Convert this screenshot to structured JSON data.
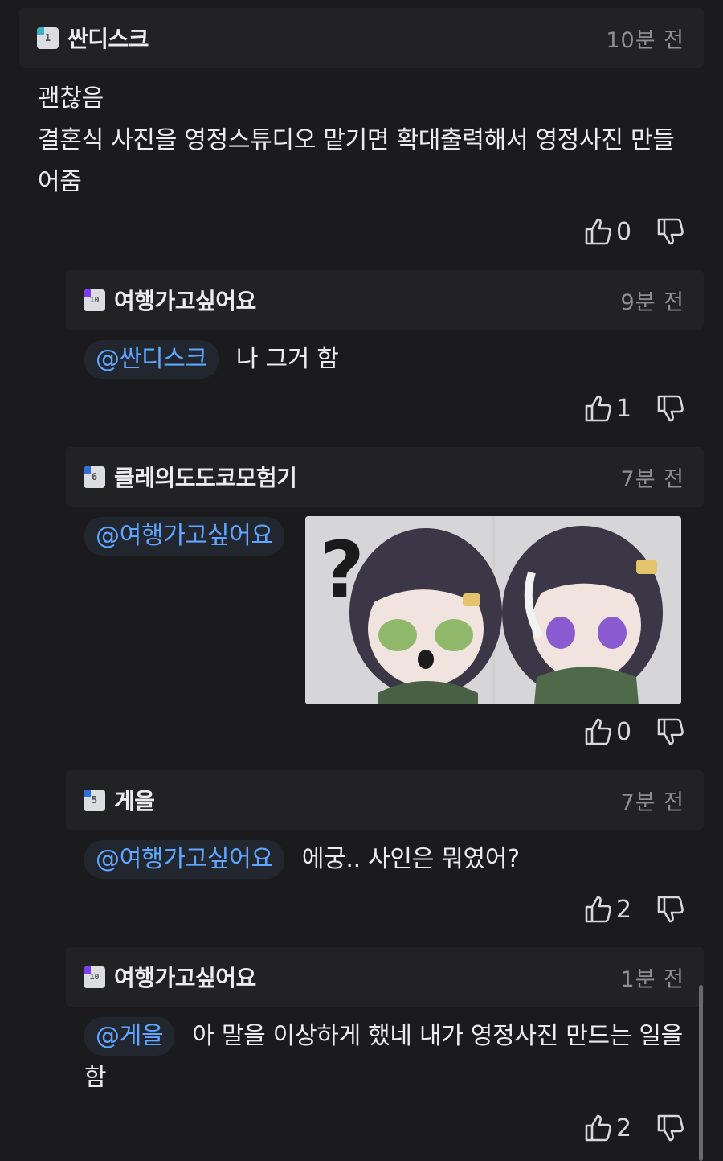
{
  "comments": [
    {
      "level": "1",
      "nickname": "싼디스크",
      "time": "10분 전",
      "mention": "",
      "text_lines": [
        "괜찮음",
        "결혼식 사진을 영정스튜디오 맡기면 확대출력해서 영정사진 만들",
        "어줌"
      ],
      "likes": "0",
      "badge_color": "#3fb0c4"
    },
    {
      "level": "10",
      "nickname": "여행가고싶어요",
      "time": "9분 전",
      "mention": "@싼디스크",
      "text": "나 그거 함",
      "likes": "1",
      "badge_color": "#7b3df0"
    },
    {
      "level": "6",
      "nickname": "클레의도도코모험기",
      "time": "7분 전",
      "mention": "@여행가고싶어요",
      "text": "",
      "image": "anime-girl-sticker",
      "likes": "0",
      "badge_color": "#2f6fd8"
    },
    {
      "level": "5",
      "nickname": "게을",
      "time": "7분 전",
      "mention": "@여행가고싶어요",
      "text": "에궁.. 사인은 뭐였어?",
      "likes": "2",
      "badge_color": "#2f6fd8"
    },
    {
      "level": "10",
      "nickname": "여행가고싶어요",
      "time": "1분 전",
      "mention": "@게을",
      "text_lines": [
        "아 말을 이상하게 했네 내가 영정사진 만드는 일을",
        "함"
      ],
      "likes": "2",
      "badge_color": "#7b3df0"
    }
  ],
  "icons": {
    "like": "thumbs-up-icon",
    "dislike": "thumbs-down-icon"
  }
}
